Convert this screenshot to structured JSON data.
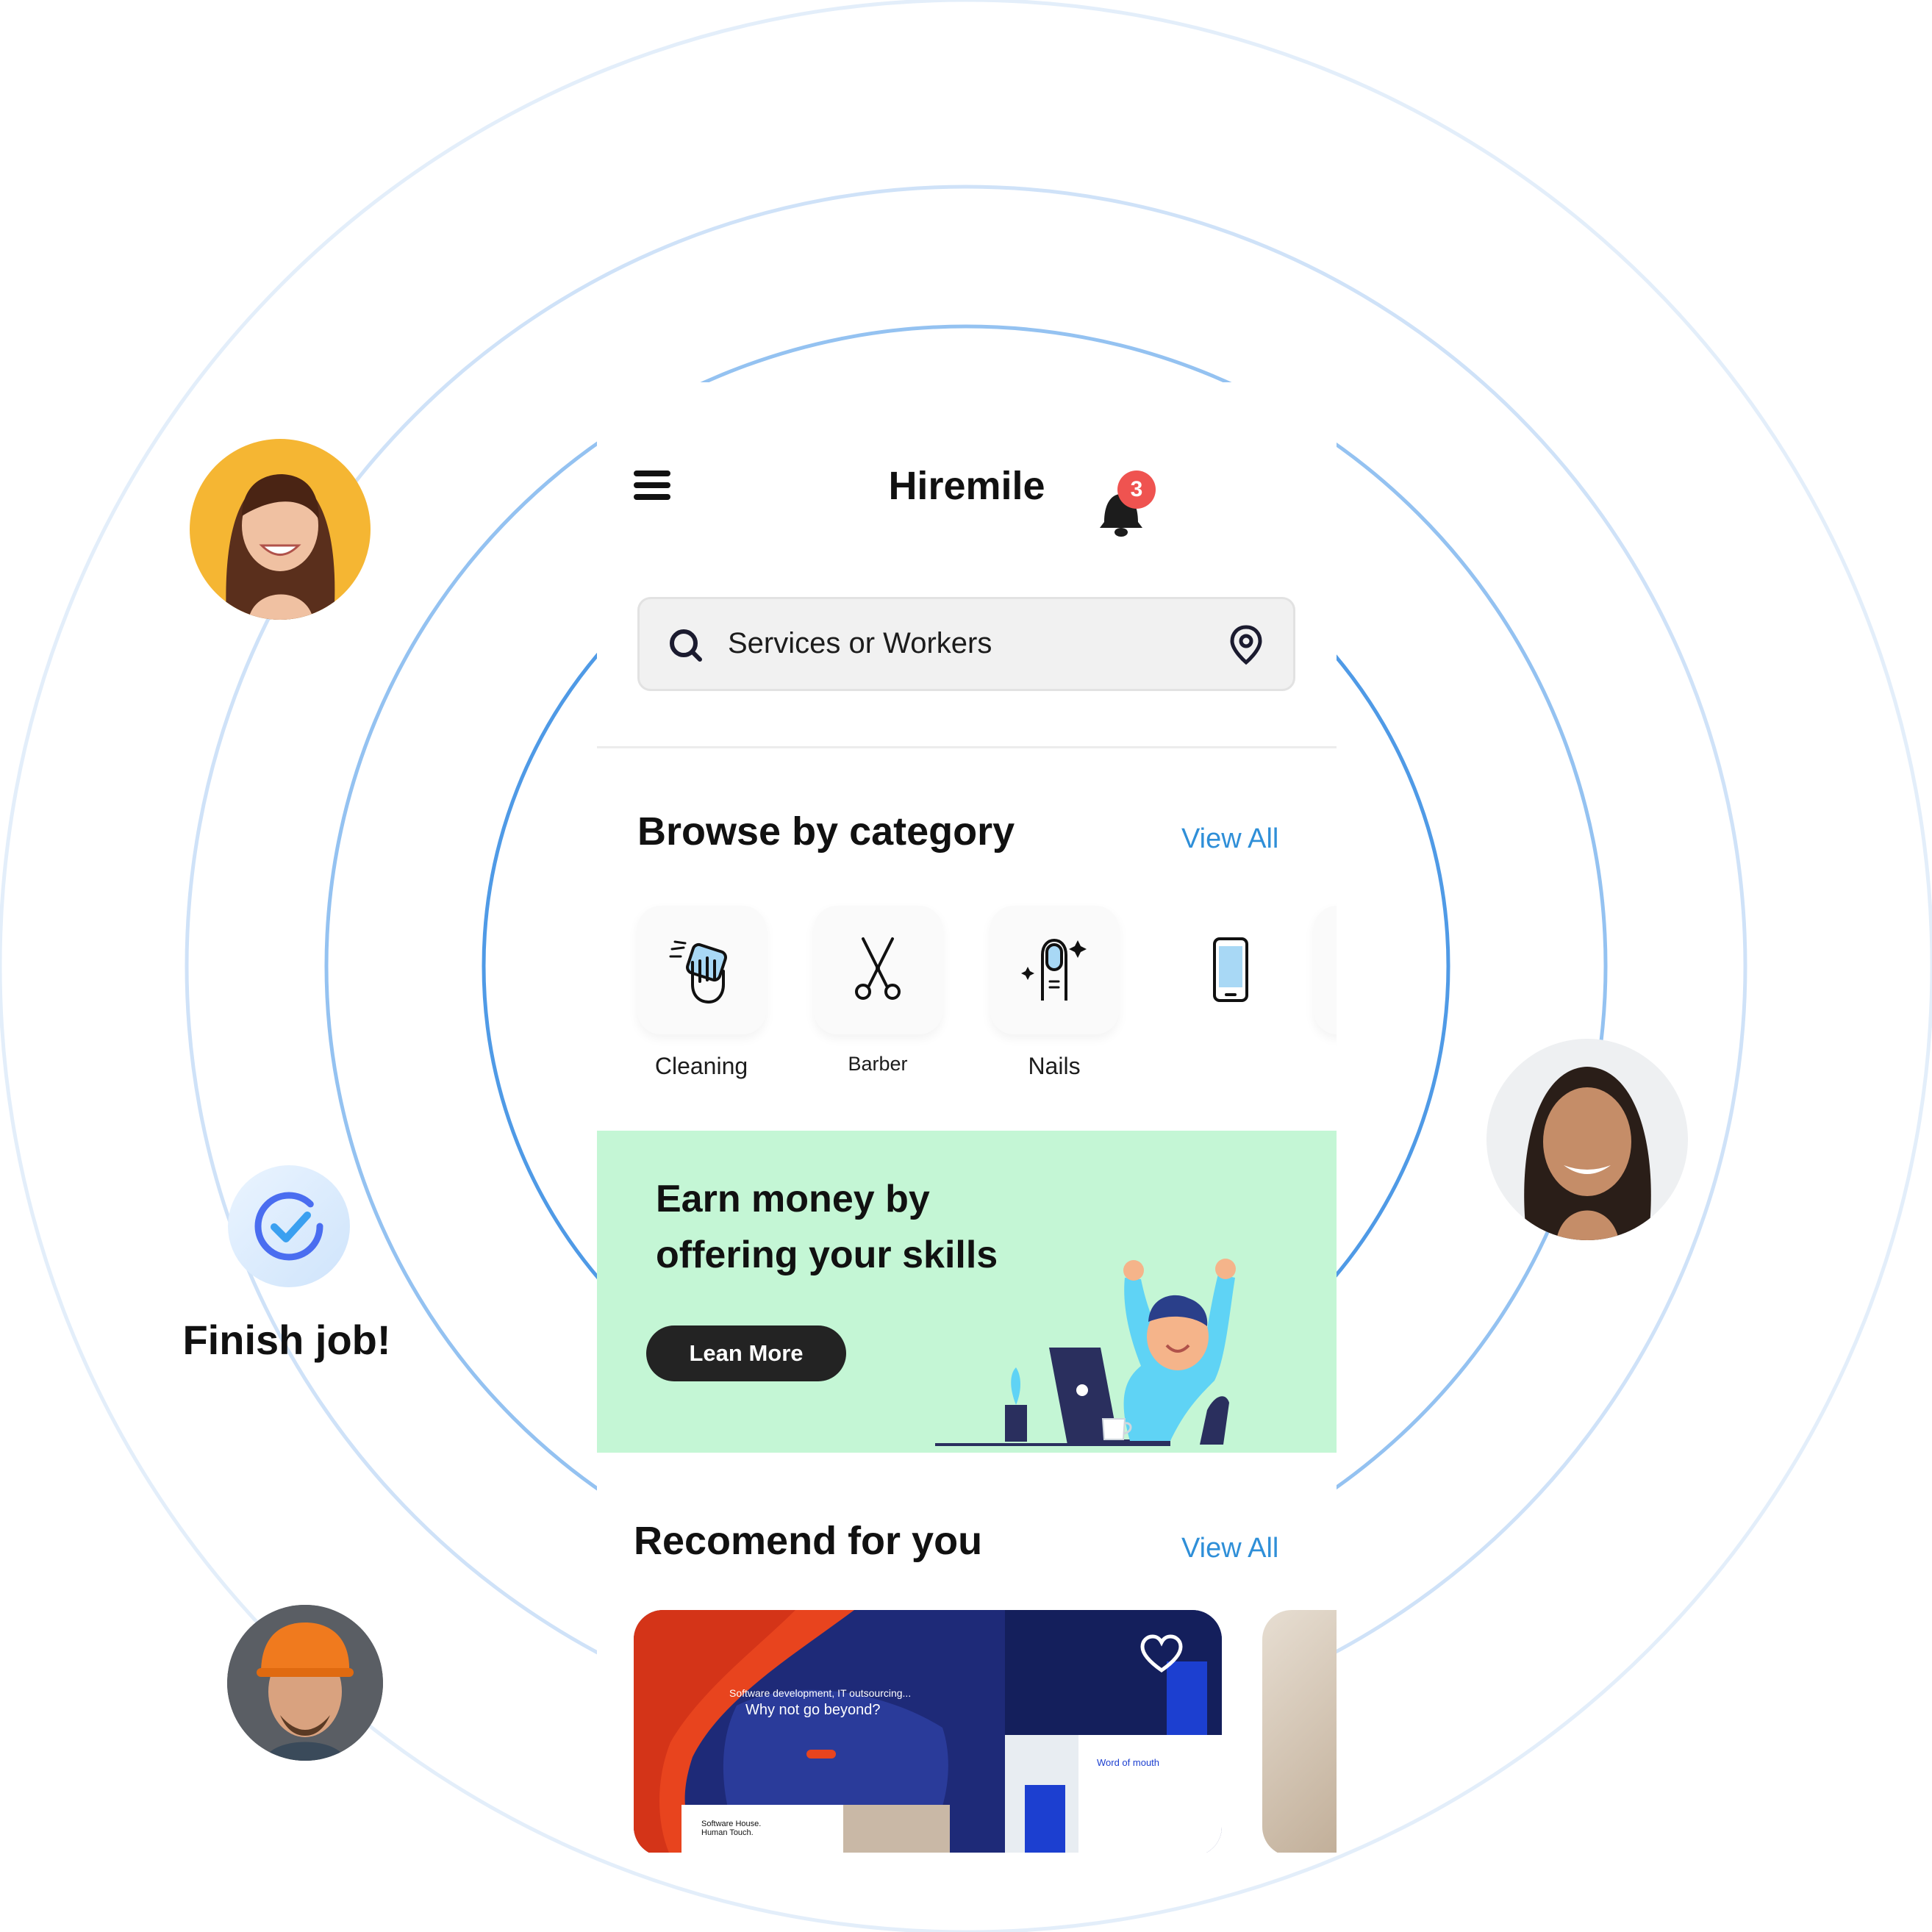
{
  "app": {
    "title": "Hiremile"
  },
  "header": {
    "notification_count": "3"
  },
  "search": {
    "placeholder": "Services or Workers"
  },
  "categories": {
    "title": "Browse by category",
    "view_all": "View All",
    "items": [
      {
        "label": "Cleaning",
        "icon": "cleaning-hand-icon"
      },
      {
        "label": "Barber",
        "icon": "scissors-icon"
      },
      {
        "label": "Nails",
        "icon": "nail-icon"
      },
      {
        "label": "",
        "icon": "smartphone-icon"
      }
    ]
  },
  "promo": {
    "line1": "Earn money by",
    "line2": "offering your skills",
    "button": "Lean More",
    "background": "#c4f6d5"
  },
  "recommend": {
    "title": "Recomend for you",
    "view_all": "View All",
    "card": {
      "heading1": "Software development, IT outsourcing...",
      "heading2": "Why not go beyond?",
      "tag": "Software House. Human Touch.",
      "quote": "Word of mouth"
    }
  },
  "floating": {
    "finish_label": "Finish job!"
  },
  "colors": {
    "accent": "#2f8fd8",
    "ring": "#4f9ae6",
    "badge": "#ef5350",
    "button": "#232323"
  }
}
